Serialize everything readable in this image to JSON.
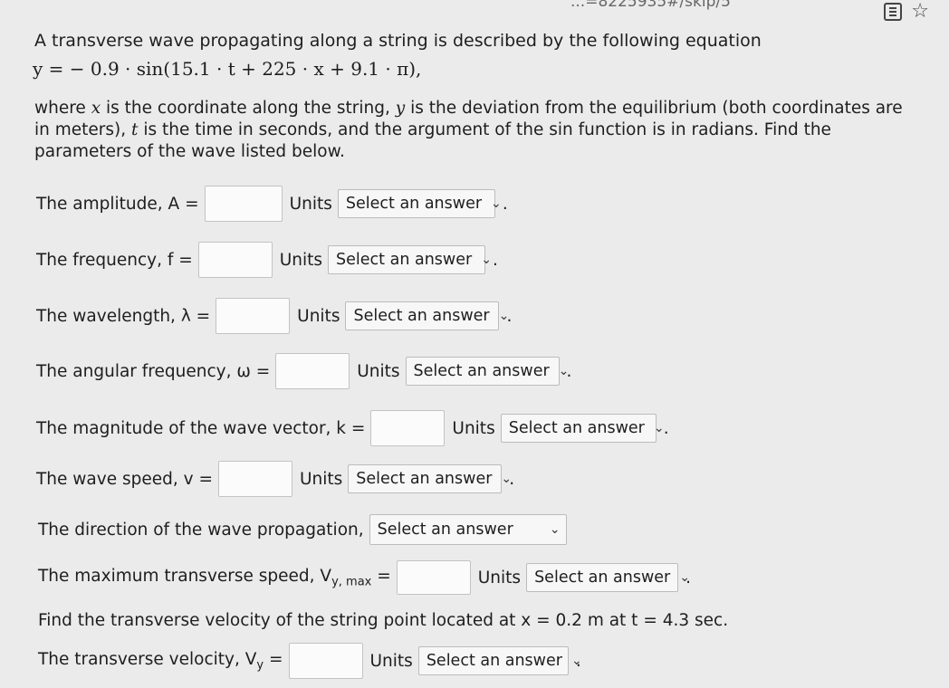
{
  "header": {
    "url_fragment": "...=8225935#/skip/5"
  },
  "problem": {
    "title": "A transverse wave propagating along a string is described by the following equation",
    "equation": "y =  − 0.9 · sin(15.1 · t + 225 · x + 9.1 · π),",
    "description_1": "where ",
    "var_x": "x",
    "description_2": " is the coordinate along the string, ",
    "var_y": "y",
    "description_3": " is the deviation from the equilibrium (both coordinates are in meters), ",
    "var_t": "t",
    "description_4": " is the time in seconds, and the argument of the sin function is in radians. Find the parameters of the wave listed below."
  },
  "units_label": "Units",
  "select_placeholder": "Select an answer",
  "rows": {
    "amplitude": {
      "label": "The amplitude, A ="
    },
    "frequency": {
      "label": "The frequency, f ="
    },
    "wavelength": {
      "label": "The wavelength, λ ="
    },
    "angular": {
      "label": "The angular frequency, ω ="
    },
    "wavevector": {
      "label": "The magnitude of the wave vector, k ="
    },
    "speed": {
      "label": "The wave speed, v ="
    },
    "direction": {
      "label": "The direction of the wave propagation,"
    },
    "vmax": {
      "label": "The maximum transverse speed, V",
      "sub": "y, max",
      "eq": " ="
    },
    "transverse": {
      "label": "The transverse velocity, V",
      "sub": "y",
      "eq": " ="
    }
  },
  "find_text": "Find the transverse velocity of the string point located at x = 0.2 m at t = 4.3 sec."
}
